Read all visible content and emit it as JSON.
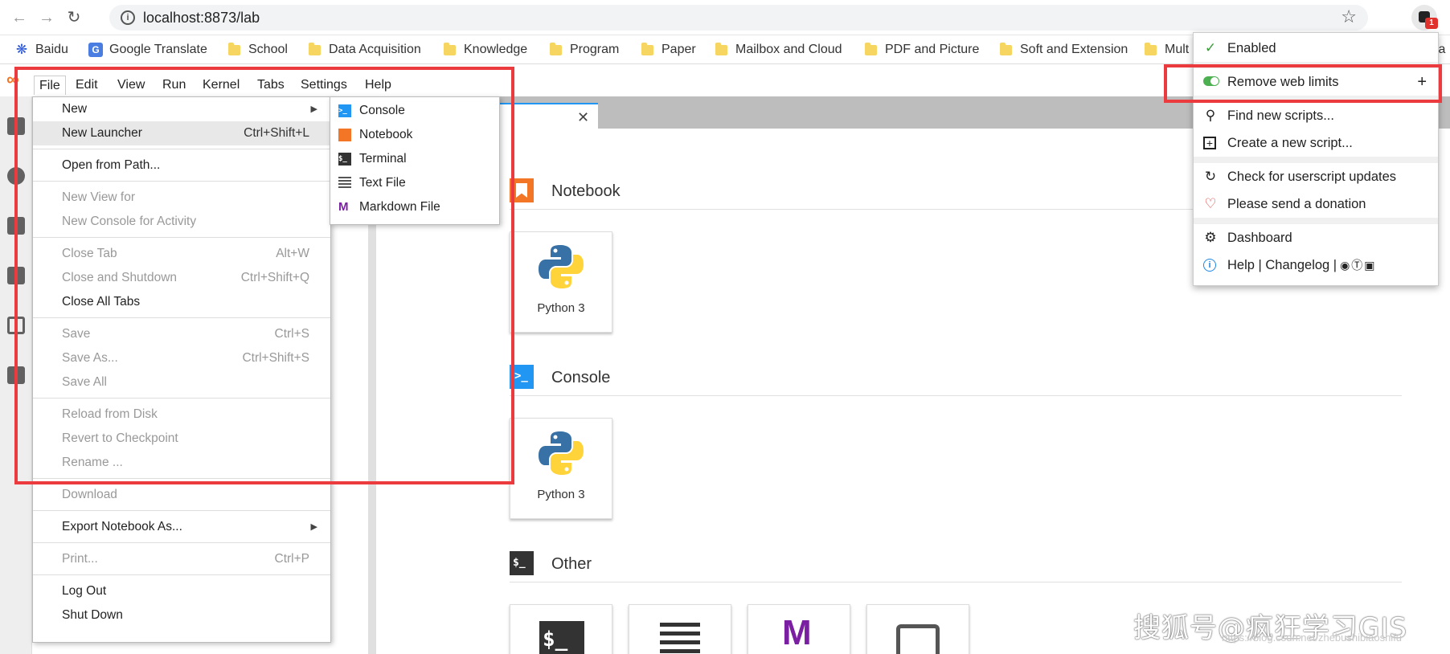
{
  "browser": {
    "url": "localhost:8873/lab",
    "extension_badge": "1",
    "bookmarks": [
      "Baidu",
      "Google Translate",
      "School",
      "Data Acquisition",
      "Knowledge",
      "Program",
      "Paper",
      "Mailbox and Cloud",
      "PDF and Picture",
      "Soft and Extension",
      "Mult",
      "Ca"
    ]
  },
  "menubar": [
    "File",
    "Edit",
    "View",
    "Run",
    "Kernel",
    "Tabs",
    "Settings",
    "Help"
  ],
  "file_menu": {
    "new": "New",
    "new_launcher": "New Launcher",
    "new_launcher_sc": "Ctrl+Shift+L",
    "open_from_path": "Open from Path...",
    "new_view_for": "New View for",
    "new_console_for_activity": "New Console for Activity",
    "close_tab": "Close Tab",
    "close_tab_sc": "Alt+W",
    "close_and_shutdown": "Close and Shutdown",
    "close_and_shutdown_sc": "Ctrl+Shift+Q",
    "close_all_tabs": "Close All Tabs",
    "save": "Save",
    "save_sc": "Ctrl+S",
    "save_as": "Save As...",
    "save_as_sc": "Ctrl+Shift+S",
    "save_all": "Save All",
    "reload_from_disk": "Reload from Disk",
    "revert_to_checkpoint": "Revert to Checkpoint",
    "rename": "Rename ...",
    "download": "Download",
    "export_notebook_as": "Export Notebook As...",
    "print": "Print...",
    "print_sc": "Ctrl+P",
    "log_out": "Log Out",
    "shut_down": "Shut Down"
  },
  "new_submenu": [
    "Console",
    "Notebook",
    "Terminal",
    "Text File",
    "Markdown File"
  ],
  "launcher": {
    "notebook_section": "Notebook",
    "console_section": "Console",
    "other_section": "Other",
    "kernel_label": "Python 3",
    "terminal_glyph": "$_",
    "markdown_glyph": "M"
  },
  "extension_menu": {
    "enabled": "Enabled",
    "script": "Remove web limits",
    "add": "+",
    "find_scripts": "Find new scripts...",
    "create_script": "Create a new script...",
    "check_updates": "Check for userscript updates",
    "donate": "Please send a donation",
    "dashboard": "Dashboard",
    "help": "Help | Changelog |"
  },
  "watermark": "搜狐号@疯狂学习GIS",
  "watermark_sub": "https://blog.csdn.net/zhebushibiaoshifu",
  "colors": {
    "highlight": "#ec3b3f",
    "jupyter_orange": "#f37626",
    "console_blue": "#2196f3",
    "markdown_purple": "#7b1fa2"
  }
}
